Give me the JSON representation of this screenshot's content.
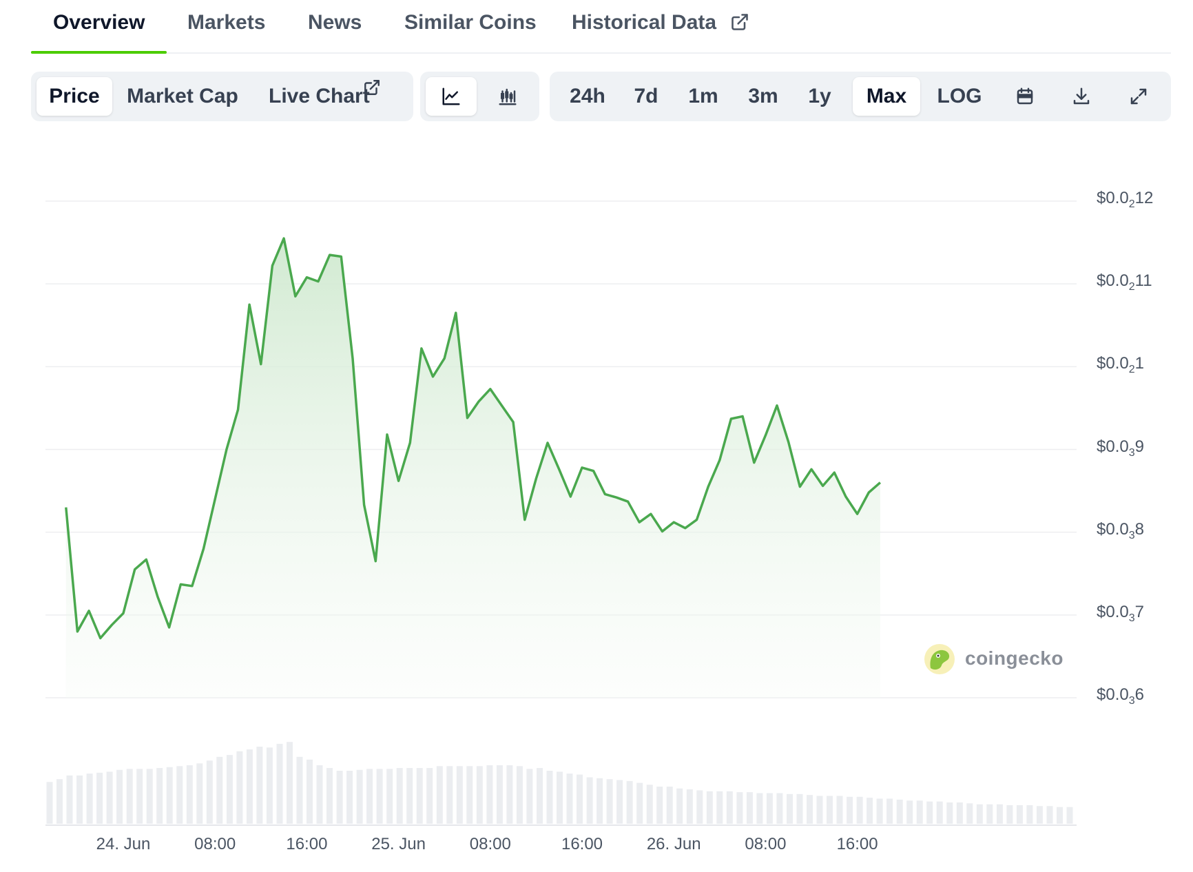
{
  "tabs": [
    {
      "label": "Overview",
      "active": true
    },
    {
      "label": "Markets",
      "active": false
    },
    {
      "label": "News",
      "active": false
    },
    {
      "label": "Similar Coins",
      "active": false
    },
    {
      "label": "Historical Data",
      "active": false
    }
  ],
  "toolbar": {
    "view": {
      "price": "Price",
      "market_cap": "Market Cap",
      "live_chart": "Live Chart",
      "selected": "Price"
    },
    "chart_style": {
      "options": [
        "line-chart-icon",
        "candlestick-icon"
      ],
      "selected": "line-chart-icon"
    },
    "ranges": [
      "24h",
      "7d",
      "1m",
      "3m",
      "1y",
      "Max"
    ],
    "selected_range": "Max",
    "log": "LOG",
    "icons": [
      "calendar-icon",
      "download-icon",
      "fullscreen-icon"
    ]
  },
  "chart_data": {
    "type": "area",
    "yscale": "linear",
    "ylim": [
      6e-07,
      1.2e-06
    ],
    "ytick_labels": [
      {
        "main": "$0.0",
        "sub": "2",
        "rest": "12"
      },
      {
        "main": "$0.0",
        "sub": "2",
        "rest": "11"
      },
      {
        "main": "$0.0",
        "sub": "2",
        "rest": "1"
      },
      {
        "main": "$0.0",
        "sub": "3",
        "rest": "9"
      },
      {
        "main": "$0.0",
        "sub": "3",
        "rest": "8"
      },
      {
        "main": "$0.0",
        "sub": "3",
        "rest": "7"
      },
      {
        "main": "$0.0",
        "sub": "3",
        "rest": "6"
      }
    ],
    "xtick_labels": [
      "24. Jun",
      "08:00",
      "16:00",
      "25. Jun",
      "08:00",
      "16:00",
      "26. Jun",
      "08:00",
      "16:00"
    ],
    "x_unit": "hours since 24. Jun 00:00",
    "x": [
      -5,
      -4,
      -3,
      -2,
      -1,
      0,
      1,
      2,
      3,
      4,
      5,
      6,
      7,
      8,
      9,
      10,
      11,
      12,
      13,
      14,
      15,
      16,
      17,
      18,
      19,
      20,
      21,
      22,
      23,
      24,
      25,
      26,
      27,
      28,
      29,
      30,
      31,
      32,
      33,
      34,
      35,
      36,
      37,
      38,
      39,
      40,
      41,
      42,
      43,
      44,
      45,
      46,
      47,
      48,
      49,
      50,
      51,
      52,
      53,
      54,
      55,
      56,
      57,
      58,
      59,
      60,
      61,
      62,
      63,
      64,
      65,
      66,
      67,
      68,
      69,
      70,
      71
    ],
    "price": [
      8.3e-07,
      6.8e-07,
      7.05e-07,
      6.72e-07,
      6.88e-07,
      7.02e-07,
      7.55e-07,
      7.67e-07,
      7.22e-07,
      6.85e-07,
      7.37e-07,
      7.35e-07,
      7.8e-07,
      8.4e-07,
      9e-07,
      9.48e-07,
      1.075e-06,
      1.003e-06,
      1.122e-06,
      1.155e-06,
      1.085e-06,
      1.108e-06,
      1.103e-06,
      1.135e-06,
      1.133e-06,
      1.01e-06,
      8.33e-07,
      7.65e-07,
      9.18e-07,
      8.62e-07,
      9.08e-07,
      1.022e-06,
      9.88e-07,
      1.01e-06,
      1.065e-06,
      9.38e-07,
      9.58e-07,
      9.73e-07,
      9.53e-07,
      9.33e-07,
      8.15e-07,
      8.65e-07,
      9.08e-07,
      8.76e-07,
      8.43e-07,
      8.78e-07,
      8.74e-07,
      8.46e-07,
      8.42e-07,
      8.37e-07,
      8.12e-07,
      8.22e-07,
      8.01e-07,
      8.12e-07,
      8.05e-07,
      8.15e-07,
      8.55e-07,
      8.87e-07,
      9.37e-07,
      9.4e-07,
      8.84e-07,
      9.17e-07,
      9.53e-07,
      9.09e-07,
      8.55e-07,
      8.76e-07,
      8.56e-07,
      8.72e-07,
      8.43e-07,
      8.22e-07,
      8.48e-07,
      8.6e-07
    ],
    "volume_relative": [
      0.45,
      0.48,
      0.52,
      0.52,
      0.54,
      0.55,
      0.56,
      0.58,
      0.59,
      0.59,
      0.59,
      0.6,
      0.61,
      0.62,
      0.63,
      0.65,
      0.68,
      0.72,
      0.74,
      0.78,
      0.8,
      0.83,
      0.82,
      0.86,
      0.88,
      0.72,
      0.69,
      0.63,
      0.6,
      0.57,
      0.57,
      0.58,
      0.59,
      0.59,
      0.59,
      0.6,
      0.6,
      0.6,
      0.6,
      0.62,
      0.62,
      0.62,
      0.62,
      0.62,
      0.63,
      0.63,
      0.63,
      0.62,
      0.59,
      0.6,
      0.57,
      0.56,
      0.54,
      0.53,
      0.5,
      0.49,
      0.48,
      0.47,
      0.46,
      0.44,
      0.42,
      0.4,
      0.4,
      0.38,
      0.37,
      0.36,
      0.35,
      0.35,
      0.35,
      0.34,
      0.34,
      0.33,
      0.33,
      0.33,
      0.32,
      0.32,
      0.31,
      0.3,
      0.3,
      0.3,
      0.29,
      0.29,
      0.28,
      0.27,
      0.27,
      0.26,
      0.25,
      0.25,
      0.24,
      0.24,
      0.23,
      0.23,
      0.22,
      0.21,
      0.21,
      0.21,
      0.2,
      0.2,
      0.2,
      0.19,
      0.19,
      0.18,
      0.18
    ],
    "line_color": "#4aa84e",
    "fill_color": "#dcefdc",
    "volume_color": "#ebedf0",
    "grid": true
  },
  "watermark": {
    "text": "coingecko",
    "icon": "coingecko-logo-icon"
  }
}
